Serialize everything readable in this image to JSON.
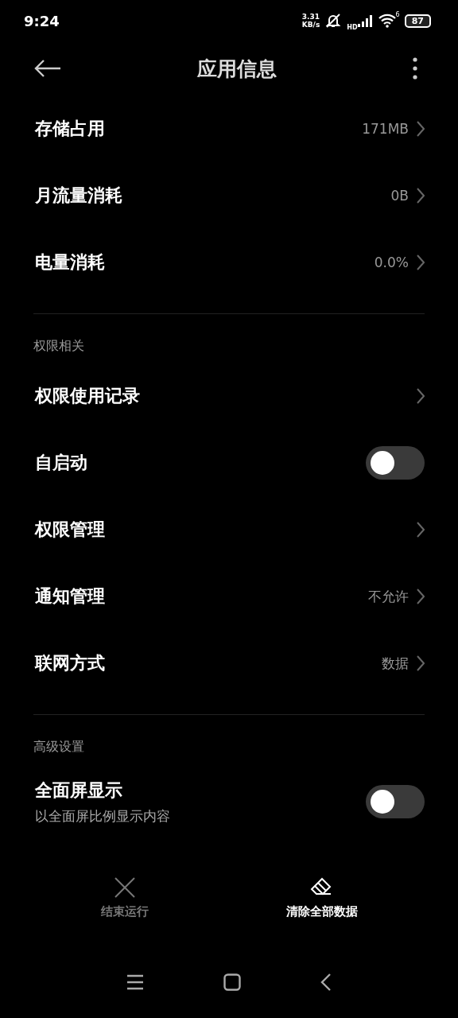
{
  "status_bar": {
    "time": "9:24",
    "speed": "3.31",
    "speed_unit": "KB/s",
    "network": "HD",
    "wifi_badge": "6",
    "battery": "87"
  },
  "header": {
    "title": "应用信息"
  },
  "sections": [
    {
      "rows": [
        {
          "kind": "link",
          "label": "存储占用",
          "value": "171MB"
        },
        {
          "kind": "link",
          "label": "月流量消耗",
          "value": "0B"
        },
        {
          "kind": "link",
          "label": "电量消耗",
          "value": "0.0%"
        }
      ]
    },
    {
      "title": "权限相关",
      "rows": [
        {
          "kind": "link",
          "label": "权限使用记录"
        },
        {
          "kind": "toggle",
          "label": "自启动",
          "on": false
        },
        {
          "kind": "link",
          "label": "权限管理"
        },
        {
          "kind": "link",
          "label": "通知管理",
          "value": "不允许"
        },
        {
          "kind": "link",
          "label": "联网方式",
          "value": "数据"
        }
      ]
    },
    {
      "title": "高级设置",
      "rows": [
        {
          "kind": "toggle",
          "label": "全面屏显示",
          "subtitle": "以全面屏比例显示内容",
          "on": false
        }
      ]
    }
  ],
  "actions": [
    {
      "kind": "close",
      "label": "结束运行",
      "disabled": true
    },
    {
      "kind": "eraser",
      "label": "清除全部数据",
      "disabled": false
    }
  ]
}
